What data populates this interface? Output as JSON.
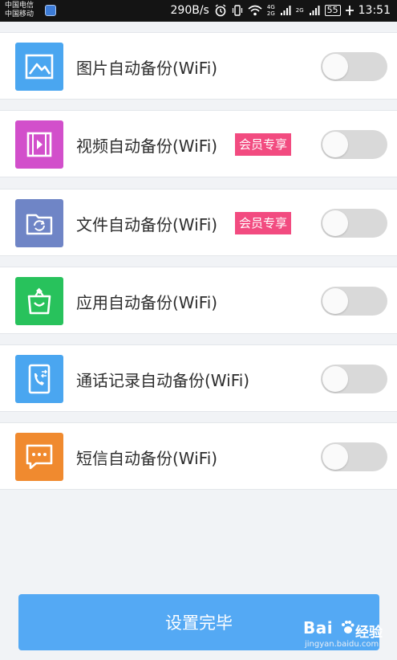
{
  "status_bar": {
    "carrier_1": "中国电信",
    "carrier_2": "中国移动",
    "speed": "290B/s",
    "net_top": "4G",
    "net_bottom": "2G",
    "net_right": "2G",
    "battery": "55",
    "time": "13:51"
  },
  "items": [
    {
      "label": "图片自动备份(WiFi)",
      "icon": "image-icon",
      "color": "#4aa6f0",
      "vip": "",
      "enabled": false
    },
    {
      "label": "视频自动备份(WiFi)",
      "icon": "video-icon",
      "color": "#d24fcb",
      "vip": "会员专享",
      "enabled": false
    },
    {
      "label": "文件自动备份(WiFi)",
      "icon": "folder-sync-icon",
      "color": "#6f85c6",
      "vip": "会员专享",
      "enabled": false
    },
    {
      "label": "应用自动备份(WiFi)",
      "icon": "shopping-bag-icon",
      "color": "#28c25c",
      "vip": "",
      "enabled": false
    },
    {
      "label": "通话记录自动备份(WiFi)",
      "icon": "phone-log-icon",
      "color": "#4aa6f0",
      "vip": "",
      "enabled": false
    },
    {
      "label": "短信自动备份(WiFi)",
      "icon": "message-icon",
      "color": "#f08a2f",
      "vip": "",
      "enabled": false
    }
  ],
  "footer": {
    "done_label": "设置完毕"
  },
  "watermark": {
    "brand": "Bai",
    "brand_cn": "经验",
    "url": "jingyan.baidu.com"
  }
}
